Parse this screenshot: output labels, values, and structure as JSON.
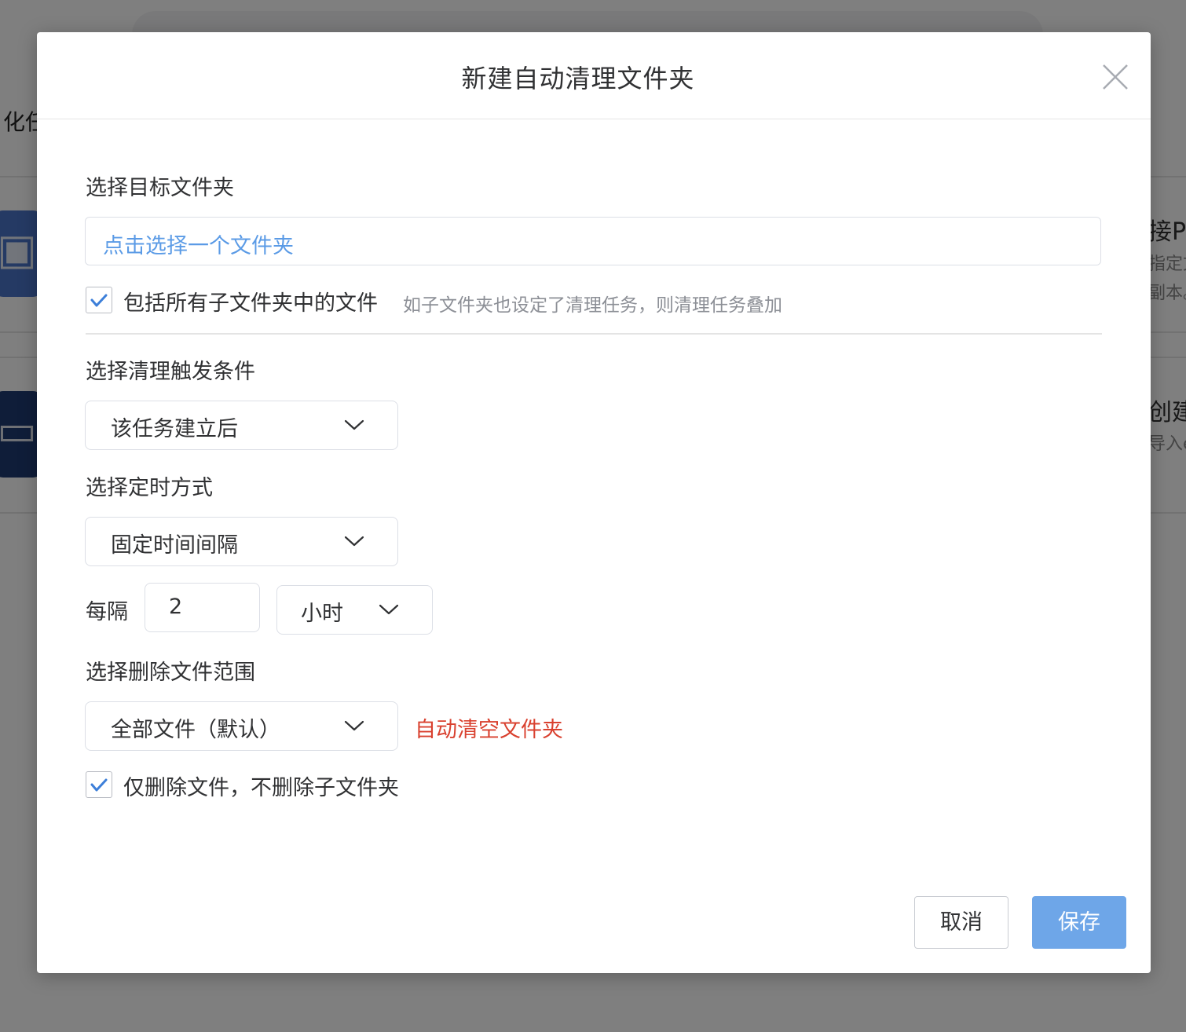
{
  "background": {
    "left_heading_fragment": "化任",
    "right_fragment_1": "接PD",
    "right_fragment_2": "指定文",
    "right_fragment_3": "副本。",
    "right_fragment_4": "创建文",
    "right_fragment_5": "导入e"
  },
  "dialog": {
    "title": "新建自动清理文件夹",
    "close_icon": "close-icon"
  },
  "target_folder": {
    "label": "选择目标文件夹",
    "placeholder": "点击选择一个文件夹",
    "include_subfolders": {
      "checked": true,
      "label": "包括所有子文件夹中的文件",
      "hint": "如子文件夹也设定了清理任务，则清理任务叠加"
    }
  },
  "trigger": {
    "label": "选择清理触发条件",
    "selected": "该任务建立后"
  },
  "timing": {
    "label": "选择定时方式",
    "selected": "固定时间间隔",
    "interval_label": "每隔",
    "interval_value": "2",
    "interval_unit": "小时"
  },
  "delete_scope": {
    "label": "选择删除文件范围",
    "selected": "全部文件（默认）",
    "warning": "自动清空文件夹",
    "files_only": {
      "checked": true,
      "label": "仅删除文件，不删除子文件夹"
    }
  },
  "footer": {
    "cancel_label": "取消",
    "save_label": "保存"
  },
  "colors": {
    "accent": "#5b9be6",
    "primary_button": "#6ea6e8",
    "warning": "#d9412f",
    "check": "#3d7fd9"
  }
}
